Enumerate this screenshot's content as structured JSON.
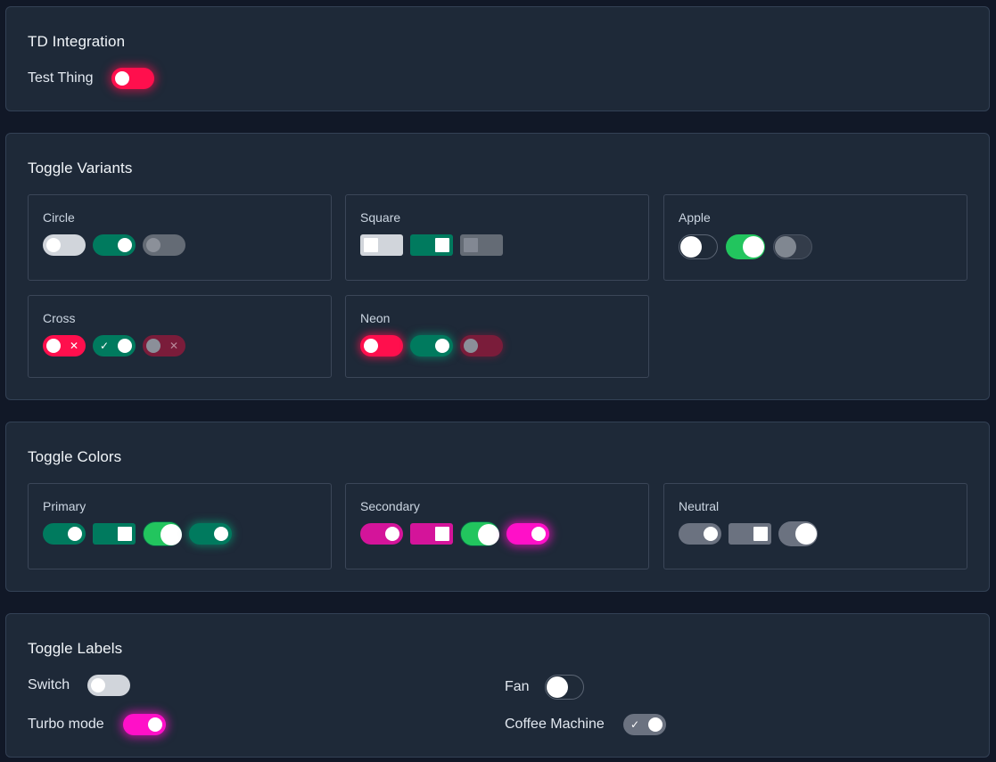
{
  "td": {
    "title": "TD Integration",
    "test_thing_label": "Test Thing"
  },
  "variants": {
    "title": "Toggle Variants",
    "circle": "Circle",
    "square": "Square",
    "apple": "Apple",
    "cross": "Cross",
    "neon": "Neon",
    "cross_glyph": "✕",
    "check_glyph": "✓"
  },
  "colors": {
    "title": "Toggle Colors",
    "primary": "Primary",
    "secondary": "Secondary",
    "neutral": "Neutral"
  },
  "labels": {
    "title": "Toggle Labels",
    "switch": "Switch",
    "fan": "Fan",
    "turbo": "Turbo mode",
    "coffee": "Coffee Machine",
    "coffee_glyph": "✓"
  },
  "palette": {
    "background": "#111827",
    "card": "#1e2938",
    "primary": "#007a5e",
    "secondary": "#d4149a",
    "neon_red": "#ff0f4d",
    "apple_green": "#22c55e",
    "neutral": "#6b7280"
  }
}
